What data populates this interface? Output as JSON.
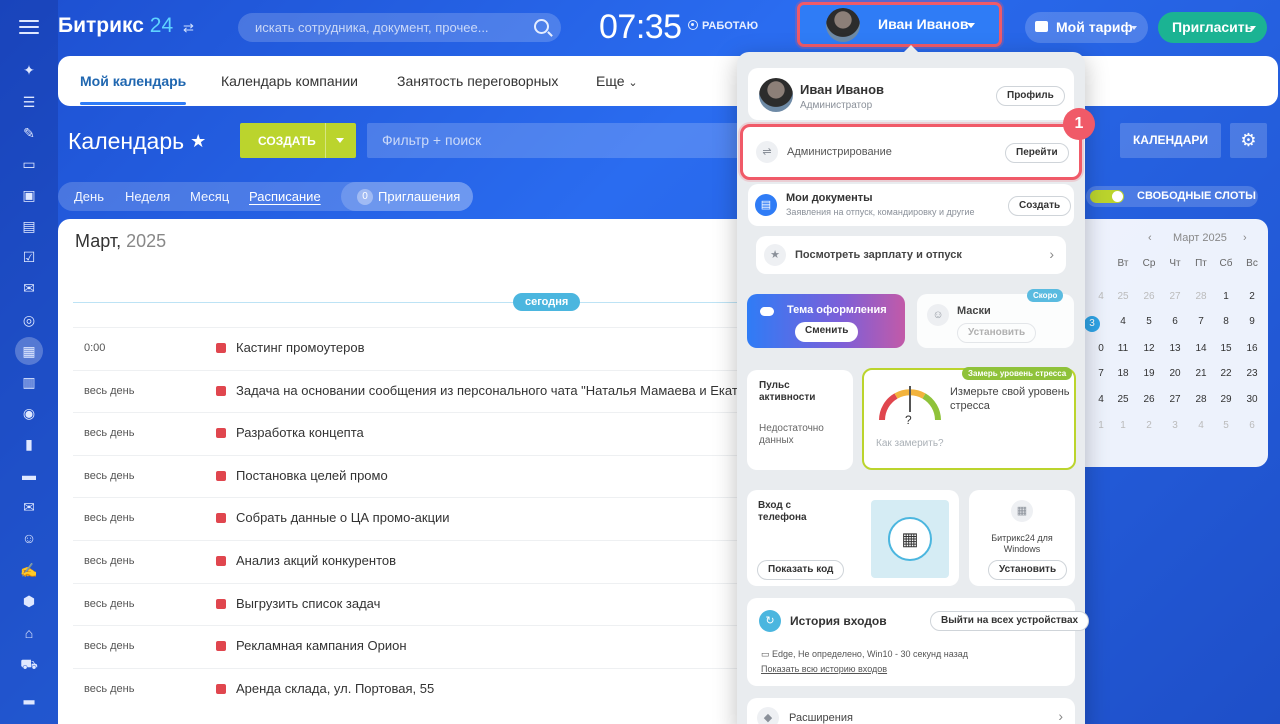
{
  "header": {
    "logo": "Битрикс",
    "logo_num": "24",
    "search_placeholder": "искать сотрудника, документ, прочее...",
    "time": "07:35",
    "work_status": "РАБОТАЮ",
    "user_name": "Иван Иванов",
    "tariff": "Мой тариф",
    "invite": "Пригласить"
  },
  "tabs": [
    {
      "label": "Мой календарь"
    },
    {
      "label": "Календарь компании"
    },
    {
      "label": "Занятость переговорных"
    },
    {
      "label": "Еще"
    }
  ],
  "toolbar": {
    "title": "Календарь",
    "create": "СОЗДАТЬ",
    "filter_placeholder": "Фильтр + поиск",
    "calendars": "КАЛЕНДАРИ"
  },
  "views": [
    {
      "label": "День"
    },
    {
      "label": "Неделя"
    },
    {
      "label": "Месяц"
    },
    {
      "label": "Расписание"
    }
  ],
  "invitations": {
    "count": "0",
    "label": "Приглашения"
  },
  "free_slots": "СВОБОДНЫЕ СЛОТЫ",
  "schedule": {
    "month": "Март,",
    "year": "2025",
    "today": "сегодня",
    "events": [
      {
        "time": "0:00",
        "title": "Кастинг промоутеров"
      },
      {
        "time": "весь день",
        "title": "Задача на основании сообщения из персонального чата \"Наталья Мамаева и Екатерина"
      },
      {
        "time": "весь день",
        "title": "Разработка концепта"
      },
      {
        "time": "весь день",
        "title": "Постановка целей промо"
      },
      {
        "time": "весь день",
        "title": "Собрать данные о ЦА промо-акции"
      },
      {
        "time": "весь день",
        "title": "Анализ акций конкурентов"
      },
      {
        "time": "весь день",
        "title": "Выгрузить список задач"
      },
      {
        "time": "весь день",
        "title": "Рекламная кампания Орион"
      },
      {
        "time": "весь день",
        "title": "Аренда склада, ул. Портовая, 55"
      }
    ]
  },
  "mini_calendar": {
    "title": "Март 2025",
    "prev": "‹",
    "next": "›",
    "weekdays": [
      "Вт",
      "Ср",
      "Чт",
      "Пт",
      "Сб",
      "Вс"
    ],
    "weeks": [
      [
        "25",
        "26",
        "27",
        "28",
        "1",
        "2"
      ],
      [
        "4",
        "5",
        "6",
        "7",
        "8",
        "9"
      ],
      [
        "11",
        "12",
        "13",
        "14",
        "15",
        "16"
      ],
      [
        "18",
        "19",
        "20",
        "21",
        "22",
        "23"
      ],
      [
        "25",
        "26",
        "27",
        "28",
        "29",
        "30"
      ],
      [
        "1",
        "2",
        "3",
        "4",
        "5",
        "6"
      ]
    ],
    "left_col": [
      "4",
      "3",
      "0",
      "7",
      "4",
      "1"
    ]
  },
  "popup": {
    "name": "Иван Иванов",
    "role": "Администратор",
    "profile": "Профиль",
    "admin": "Администрирование",
    "go": "Перейти",
    "docs_title": "Мои документы",
    "docs_sub": "Заявления на отпуск, командировку и другие",
    "docs_btn": "Создать",
    "salary": "Посмотреть зарплату и отпуск",
    "theme": "Тема оформления",
    "theme_btn": "Сменить",
    "masks": "Маски",
    "masks_badge": "Скоро",
    "masks_btn": "Установить",
    "pulse_title": "Пульс активности",
    "pulse_text": "Недостаточно данных",
    "stress_badge": "Замерь уровень стресса",
    "stress_title": "Измерьте свой уровень стресса",
    "stress_link": "Как замерить?",
    "phone_title": "Вход с телефона",
    "phone_btn": "Показать код",
    "win_title": "Битрикс24 для Windows",
    "win_btn": "Установить",
    "history_title": "История входов",
    "history_btn": "Выйти на всех устройствах",
    "history_entry": "Edge, Не определено, Win10 - 30 секунд назад",
    "history_link": "Показать всю историю входов",
    "extensions": "Расширения",
    "step": "1"
  }
}
